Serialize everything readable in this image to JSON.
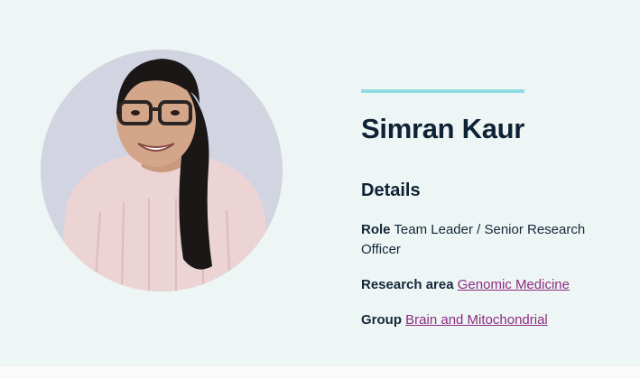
{
  "profile": {
    "name": "Simran Kaur",
    "photo_alt": "Portrait of Simran Kaur",
    "details_heading": "Details",
    "role": {
      "label": "Role",
      "value": "Team Leader / Senior Research Officer"
    },
    "research_area": {
      "label": "Research area",
      "value": "Genomic Medicine"
    },
    "group": {
      "label": "Group",
      "value": "Brain and Mitochondrial"
    }
  },
  "colors": {
    "page_background": "#eef6f5",
    "accent_line": "#8fdde3",
    "heading_text": "#0e2236",
    "link": "#8a2c80"
  }
}
